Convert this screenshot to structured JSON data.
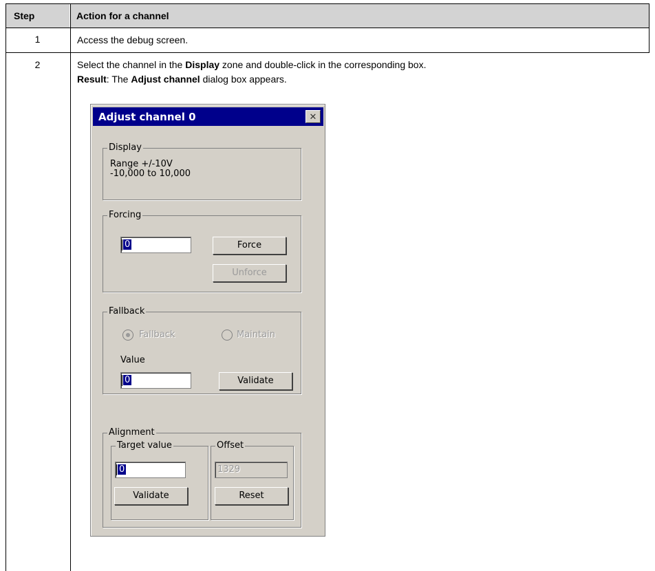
{
  "table": {
    "headers": {
      "step": "Step",
      "action": "Action for a channel"
    },
    "rows": [
      {
        "step": "1",
        "text": "Access the debug screen."
      },
      {
        "step": "2",
        "line1_pre": "Select the channel in the ",
        "line1_kw": "Display",
        "line1_post": " zone and double-click in the corresponding box.",
        "line2_kw1": "Result",
        "line2_mid": ": The ",
        "line2_kw2": "Adjust channel",
        "line2_post": " dialog box appears."
      }
    ]
  },
  "dialog": {
    "title": "Adjust channel 0",
    "close_glyph": "✕",
    "display": {
      "label": "Display",
      "line1": "Range +/-10V",
      "line2": "-10,000 to 10,000"
    },
    "forcing": {
      "label": "Forcing",
      "input_value": "0",
      "force_button": "Force",
      "unforce_button": "Unforce"
    },
    "fallback": {
      "label": "Fallback",
      "radio_fallback": "Fallback",
      "radio_maintain": "Maintain",
      "value_label": "Value",
      "input_value": "0",
      "validate_button": "Validate"
    },
    "alignment": {
      "label": "Alignment",
      "target_label": "Target value",
      "target_input": "0",
      "validate_button": "Validate",
      "offset_label": "Offset",
      "offset_value": "1329",
      "reset_button": "Reset"
    }
  }
}
